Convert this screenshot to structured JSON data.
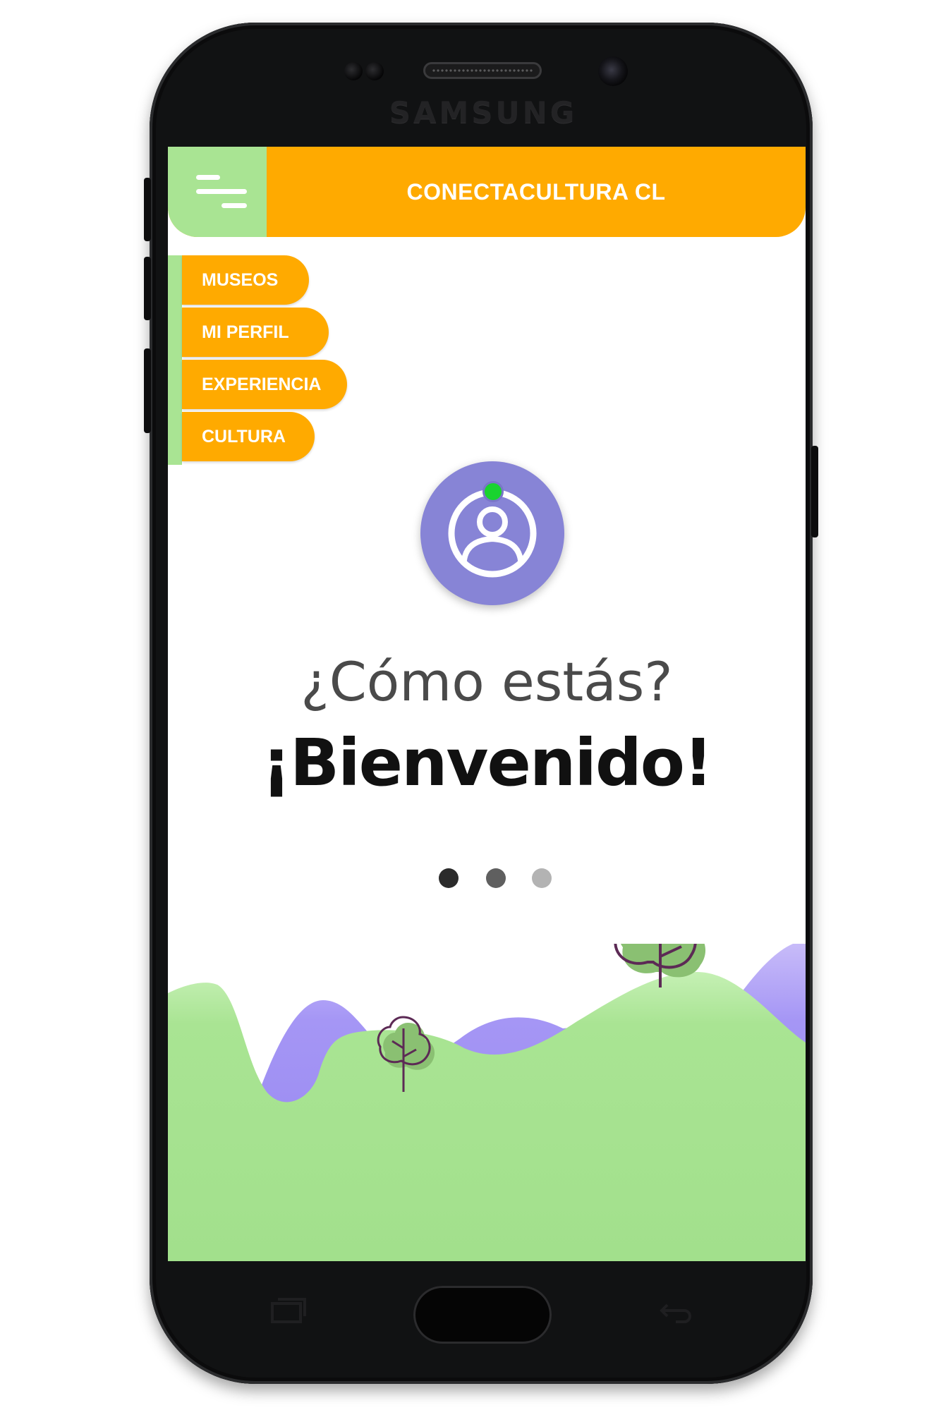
{
  "device": {
    "brand": "SAMSUNG"
  },
  "header": {
    "title": "CONECTACULTURA CL",
    "menu_icon": "hamburger-menu-icon"
  },
  "nav": {
    "items": [
      {
        "label": "MUSEOS"
      },
      {
        "label": "MI PERFIL"
      },
      {
        "label": "EXPERIENCIA"
      },
      {
        "label": "CULTURA"
      }
    ]
  },
  "profile": {
    "icon": "user-circle-icon",
    "status": "online"
  },
  "hero": {
    "greeting": "¿Cómo estás?",
    "welcome": "¡Bienvenido!"
  },
  "pager": {
    "count": 3,
    "active_index": 0
  },
  "colors": {
    "header_orange": "#ffaa00",
    "accent_green": "#a9e493",
    "avatar_purple": "#8784d6",
    "online_green": "#19d32f",
    "hill_purple": "#a596f5",
    "tree_green": "#8ac072",
    "tree_outline": "#5c2a55"
  }
}
